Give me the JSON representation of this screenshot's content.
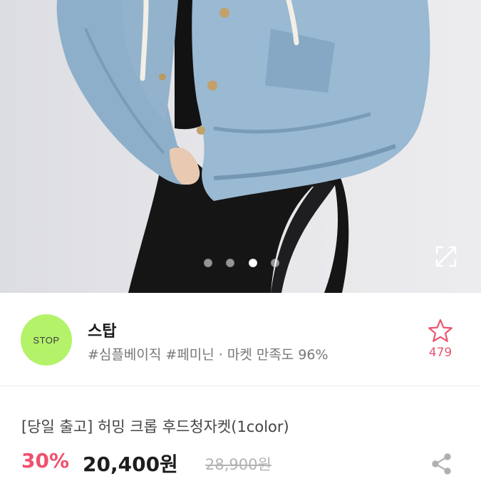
{
  "carousel": {
    "slide_count": 4,
    "active_index": 2
  },
  "shop": {
    "logo_text": "STOP",
    "logo_color": "#b4f26a",
    "name": "스탑",
    "tags": "#심플베이직 #페미닌 · 마켓 만족도 96%",
    "favorite_count": "479",
    "accent_color": "#e8566f"
  },
  "product": {
    "title": "[당일 출고]  허밍 크롭 후드청자켓(1color)",
    "discount": "30%",
    "price": "20,400원",
    "original_price": "28,900원",
    "discount_color": "#f0506e"
  },
  "icons": {
    "expand": "expand-icon",
    "favorite": "star-outline-icon",
    "share": "share-icon"
  }
}
